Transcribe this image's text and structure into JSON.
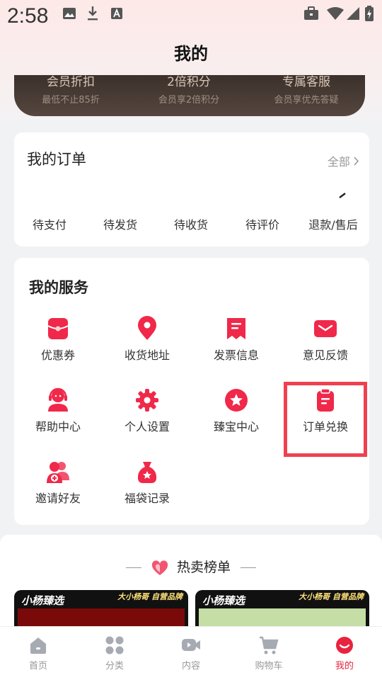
{
  "status_bar": {
    "time": "2:58"
  },
  "page": {
    "title": "我的"
  },
  "vip_benefits": [
    {
      "title": "会员折扣",
      "subtitle": "最低不止85折"
    },
    {
      "title": "2倍积分",
      "subtitle": "会员享2倍积分"
    },
    {
      "title": "专属客服",
      "subtitle": "会员享优先答疑"
    }
  ],
  "orders": {
    "title": "我的订单",
    "all_label": "全部",
    "items": [
      "待支付",
      "待发货",
      "待收货",
      "待评价",
      "退款/售后"
    ]
  },
  "services": {
    "title": "我的服务",
    "items": [
      {
        "label": "优惠券",
        "icon": "coupon-icon"
      },
      {
        "label": "收货地址",
        "icon": "location-pin-icon"
      },
      {
        "label": "发票信息",
        "icon": "invoice-icon"
      },
      {
        "label": "意见反馈",
        "icon": "envelope-icon"
      },
      {
        "label": "帮助中心",
        "icon": "headset-icon"
      },
      {
        "label": "个人设置",
        "icon": "gear-icon"
      },
      {
        "label": "臻宝中心",
        "icon": "star-badge-icon"
      },
      {
        "label": "订单兑换",
        "icon": "clipboard-icon"
      },
      {
        "label": "邀请好友",
        "icon": "invite-friends-icon"
      },
      {
        "label": "福袋记录",
        "icon": "lucky-bag-icon"
      }
    ],
    "accent_color": "#f0284a",
    "highlight_color": "#f04050"
  },
  "hot_list": {
    "title": "热卖榜单",
    "products": [
      {
        "brand": "小杨臻选",
        "tag": "大小杨哥 自营品牌",
        "color": "#7a0a0a"
      },
      {
        "brand": "小杨臻选",
        "tag": "大小杨哥 自营品牌",
        "color": "#c5dea6"
      }
    ]
  },
  "tab_bar": [
    {
      "label": "首页",
      "icon": "home-icon",
      "active": false
    },
    {
      "label": "分类",
      "icon": "category-grid-icon",
      "active": false
    },
    {
      "label": "内容",
      "icon": "video-icon",
      "active": false
    },
    {
      "label": "购物车",
      "icon": "cart-icon",
      "active": false
    },
    {
      "label": "我的",
      "icon": "profile-icon",
      "active": true
    }
  ]
}
